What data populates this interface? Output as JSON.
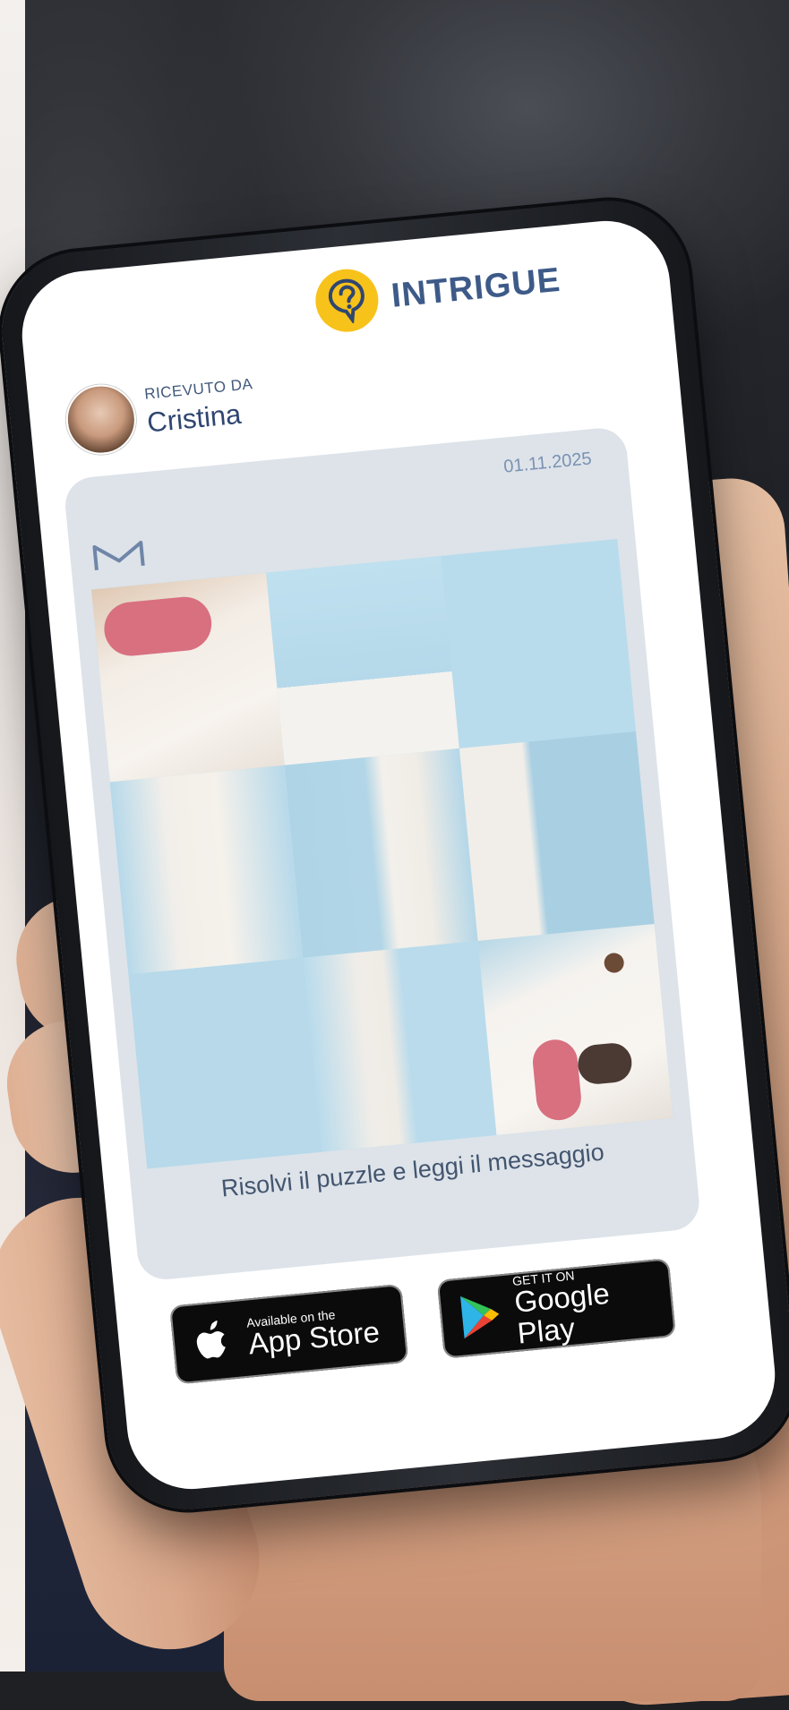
{
  "app": {
    "brand_name": "INTRIGUE",
    "logo_icon": "question-bubble-icon"
  },
  "message": {
    "received_label": "RICEVUTO DA",
    "sender_name": "Cristina",
    "date": "01.11.2025",
    "mail_icon": "m-letter-icon",
    "instruction": "Risolvi il puzzle e leggi il messaggio"
  },
  "store_badges": {
    "appstore": {
      "small": "Available on the",
      "big": "App Store",
      "icon": "apple-icon"
    },
    "googleplay": {
      "small": "GET IT ON",
      "big": "Google Play",
      "icon": "play-triangle-icon"
    }
  },
  "colors": {
    "brand_blue": "#3d5a88",
    "logo_yellow": "#f7c21a",
    "card_gray": "#dde3e9",
    "puzzle_sky": "#b9dcec"
  }
}
